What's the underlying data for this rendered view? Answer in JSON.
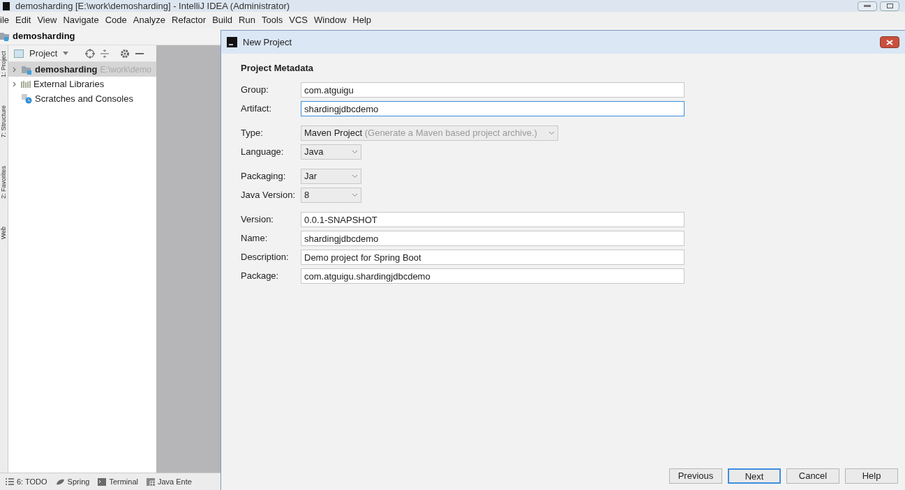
{
  "window": {
    "title": "demosharding [E:\\work\\demosharding] - IntelliJ IDEA (Administrator)"
  },
  "menu": [
    "ile",
    "Edit",
    "View",
    "Navigate",
    "Code",
    "Analyze",
    "Refactor",
    "Build",
    "Run",
    "Tools",
    "VCS",
    "Window",
    "Help"
  ],
  "nav_bar": {
    "label": "demosharding"
  },
  "side_tabs": [
    "1: Project",
    "7: Structure",
    "2: Favorites",
    "Web"
  ],
  "project_panel": {
    "title": "Project",
    "items": [
      {
        "kind": "module",
        "label": "demosharding",
        "path": "E:\\work\\demo",
        "selected": true,
        "expandable": true
      },
      {
        "kind": "libraries",
        "label": "External Libraries",
        "selected": false,
        "expandable": true
      },
      {
        "kind": "scratches",
        "label": "Scratches and Consoles",
        "selected": false,
        "expandable": false
      }
    ]
  },
  "bottom_tabs": [
    {
      "kind": "list",
      "label": "6: TODO"
    },
    {
      "kind": "leaf",
      "label": "Spring"
    },
    {
      "kind": "terminal",
      "label": "Terminal"
    },
    {
      "kind": "table",
      "label": "Java Ente"
    }
  ],
  "dialog": {
    "title": "New Project",
    "heading": "Project Metadata",
    "groups": [
      [
        {
          "kind": "text",
          "label": "Group:",
          "value": "com.atguigu",
          "focused": false
        },
        {
          "kind": "text",
          "label": "Artifact:",
          "value": "shardingjdbcdemo",
          "focused": true
        }
      ],
      [
        {
          "kind": "select",
          "label": "Type:",
          "value": "Maven Project",
          "hint": "(Generate a Maven based project archive.)"
        },
        {
          "kind": "select",
          "label": "Language:",
          "value": "Java"
        }
      ],
      [
        {
          "kind": "select",
          "label": "Packaging:",
          "value": "Jar"
        },
        {
          "kind": "select",
          "label": "Java Version:",
          "value": "8"
        }
      ],
      [
        {
          "kind": "text",
          "label": "Version:",
          "value": "0.0.1-SNAPSHOT",
          "focused": false
        },
        {
          "kind": "text",
          "label": "Name:",
          "value": "shardingjdbcdemo",
          "focused": false
        },
        {
          "kind": "text",
          "label": "Description:",
          "value": "Demo project for Spring Boot",
          "focused": false
        },
        {
          "kind": "text",
          "label": "Package:",
          "value": "com.atguigu.shardingjdbcdemo",
          "focused": false
        }
      ]
    ],
    "buttons": [
      {
        "label": "Previous",
        "default": false
      },
      {
        "label": "Next",
        "default": true
      },
      {
        "label": "Cancel",
        "default": false
      },
      {
        "label": "Help",
        "default": false
      }
    ]
  }
}
